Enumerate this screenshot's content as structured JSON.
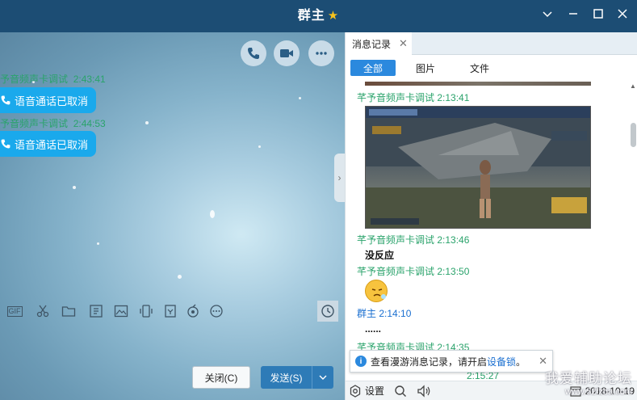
{
  "window": {
    "title": "群主",
    "controls": [
      "chevron-down",
      "minimize",
      "maximize",
      "close"
    ]
  },
  "chat": {
    "top_buttons": [
      "phone-icon",
      "video-icon",
      "more-icon"
    ],
    "messages": [
      {
        "name": "予音频声卡调试",
        "time": "2:43:41",
        "text": "语音通话已取消"
      },
      {
        "name": "予音频声卡调试",
        "time": "2:44:53",
        "text": "语音通话已取消"
      }
    ],
    "toolbar_icons": [
      "gif-icon",
      "scissors-icon",
      "folder-icon",
      "sticker-icon",
      "image-icon",
      "screen-share-icon",
      "calendar-icon",
      "music-icon",
      "more-circle-icon"
    ],
    "gif_label": "GIF",
    "close_button": "关闭(C)",
    "send_button": "发送(S)"
  },
  "history": {
    "tab_label": "消息记录",
    "filters": [
      {
        "label": "全部",
        "active": true
      },
      {
        "label": "图片",
        "active": false
      },
      {
        "label": "文件",
        "active": false
      }
    ],
    "entries": [
      {
        "name": "芊予音频声卡调试",
        "time": "2:13:41",
        "content": "[image]"
      },
      {
        "name": "芊予音频声卡调试",
        "time": "2:13:46",
        "content": "没反应"
      },
      {
        "name": "芊予音频声卡调试",
        "time": "2:13:50",
        "content": "[emoji]"
      },
      {
        "name": "群主",
        "time": "2:14:10",
        "content": "......"
      },
      {
        "name": "芊予音频声卡调试",
        "time": "2:14:35",
        "content": ""
      }
    ],
    "partial_time": "2:15:27",
    "notice": {
      "text": "查看漫游消息记录，请开启",
      "link": "设备锁",
      "suffix": "。"
    },
    "bottom": {
      "settings": "设置",
      "date": "2018-10-19"
    },
    "watermark": {
      "line1": "我爱辅助论坛",
      "line2": "www.52fzba.com"
    }
  },
  "colors": {
    "titlebar": "#1c4d74",
    "bubble": "#1aa9ec",
    "sender_name": "#2aa36b",
    "self_name": "#1a6fd0",
    "filter_active": "#2b89de",
    "send_button": "#2e7bb7"
  }
}
